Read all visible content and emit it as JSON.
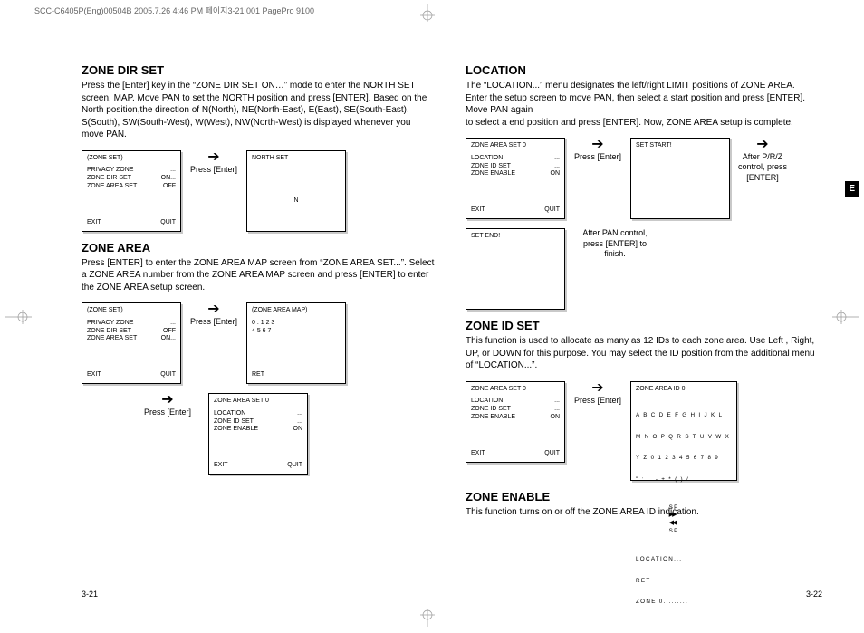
{
  "meta": {
    "header": "SCC-C6405P(Eng)00504B  2005.7.26 4:46 PM 페이지3-21  001 PagePro 9100"
  },
  "tab": {
    "label": "E"
  },
  "pageno": {
    "left": "3-21",
    "right": "3-22"
  },
  "left": {
    "s1": {
      "title": "ZONE DIR SET",
      "body": "Press the [Enter] key in the “ZONE DIR SET ON…” mode to enter the NORTH SET screen. MAP. Move PAN to set the NORTH position and press [ENTER]. Based on the North position,the direction of N(North), NE(North-East), E(East), SE(South-East), S(South), SW(South-West), W(West), NW(North-West) is displayed whenever you move PAN.",
      "box1": {
        "hdr": "(ZONE SET)",
        "r1k": "PRIVACY ZONE",
        "r1v": "...",
        "r2k": "ZONE DIR SET",
        "r2v": "ON...",
        "r3k": "ZONE AREA SET",
        "r3v": "OFF",
        "flk": "EXIT",
        "flv": "QUIT"
      },
      "arrow": {
        "icon": "➔",
        "cap": "Press\n[Enter]"
      },
      "box2": {
        "hdr": "NORTH SET",
        "mid": "N"
      }
    },
    "s2": {
      "title": "ZONE AREA",
      "body": "Press [ENTER] to enter the ZONE AREA MAP screen from “ZONE AREA SET...”. Select a ZONE AREA number from the ZONE AREA MAP screen and press [ENTER] to enter the ZONE AREA setup screen.",
      "box1": {
        "hdr": "(ZONE SET)",
        "r1k": "PRIVACY ZONE",
        "r1v": "...",
        "r2k": "ZONE DIR SET",
        "r2v": "OFF",
        "r3k": "ZONE AREA SET",
        "r3v": "ON...",
        "flk": "EXIT",
        "flv": "QUIT"
      },
      "arrow1": {
        "icon": "➔",
        "cap": "Press\n[Enter]"
      },
      "box2": {
        "hdr": "(ZONE AREA MAP)",
        "line1": "0 .    1      2      3",
        "line2": "4      5      6      7",
        "flk": "RET"
      },
      "arrow2": {
        "icon": "➔",
        "cap": "Press\n[Enter]"
      },
      "box3": {
        "hdr": "ZONE AREA SET   0",
        "r1k": "LOCATION",
        "r1v": "...",
        "r2k": "ZONE ID SET",
        "r2v": "...",
        "r3k": "ZONE ENABLE",
        "r3v": "ON",
        "flk": "EXIT",
        "flv": "QUIT"
      }
    }
  },
  "right": {
    "s1": {
      "title": "LOCATION",
      "body": "The “LOCATION...” menu designates the left/right LIMIT positions of ZONE AREA. Enter the setup screen to move PAN, then select a start position and press [ENTER]. Move PAN again\nto select a end position and press [ENTER].  Now, ZONE AREA setup is complete.",
      "box1": {
        "hdr": "ZONE AREA SET   0",
        "r1k": "LOCATION",
        "r1v": "...",
        "r2k": "ZONE ID SET",
        "r2v": "...",
        "r3k": "ZONE ENABLE",
        "r3v": "ON",
        "flk": "EXIT",
        "flv": "QUIT"
      },
      "arrow1": {
        "icon": "➔",
        "cap": "Press\n[Enter]"
      },
      "box2": {
        "hdr": "SET START!"
      },
      "arrow2": {
        "icon": "➔",
        "cap": "After P/R/Z control, press [ENTER]"
      },
      "box3": {
        "hdr": "SET END!"
      },
      "cap3": "After PAN control, press [ENTER] to finish."
    },
    "s2": {
      "title": "ZONE ID SET",
      "body": "This function is used to allocate as many as 12 IDs to each zone area. Use Left , Right, UP, or DOWN for this purpose. You may select the ID position from the additional menu  of “LOCATION...”.",
      "box1": {
        "hdr": "ZONE AREA SET   0",
        "r1k": "LOCATION",
        "r1v": "...",
        "r2k": "ZONE ID SET",
        "r2v": "...",
        "r3k": "ZONE ENABLE",
        "r3v": "ON",
        "flk": "EXIT",
        "flv": "QUIT"
      },
      "arrow": {
        "icon": "➔",
        "cap": "Press\n[Enter]"
      },
      "box2": {
        "hdr": "ZONE AREA ID 0",
        "l1": "A B C D E F G H I J K L",
        "l2": "M N O P Q R S T U V W X",
        "l3": "Y Z 0 1 2 3 4 5 6 7 8 9",
        "l4": "\" : !  - + * ( ) /",
        "sp1": "SP",
        "ff": "▶▶",
        "rw": "◀◀",
        "sp2": "SP",
        "l6": "LOCATION...",
        "l7": "RET",
        "l8": "ZONE 0........."
      }
    },
    "s3": {
      "title": "ZONE ENABLE",
      "body": "This function turns on or off the ZONE AREA ID indication."
    }
  }
}
